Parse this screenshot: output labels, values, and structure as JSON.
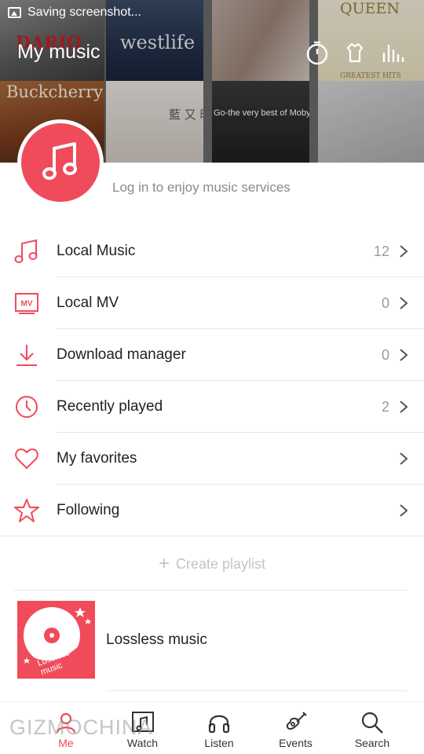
{
  "status_bar": {
    "text": "Saving screenshot..."
  },
  "header": {
    "title": "My music",
    "album_captions": [
      "DARIO",
      "westlife",
      "QUEEN",
      "GREATEST HITS",
      "Buckcherry",
      "藍 又 時",
      "Go-the very best of Moby"
    ]
  },
  "profile": {
    "login_hint": "Log in to enjoy music services"
  },
  "menu": [
    {
      "label": "Local Music",
      "count": "12",
      "icon": "music-note-icon"
    },
    {
      "label": "Local MV",
      "count": "0",
      "icon": "mv-icon"
    },
    {
      "label": "Download manager",
      "count": "0",
      "icon": "download-icon"
    },
    {
      "label": "Recently played",
      "count": "2",
      "icon": "clock-icon"
    },
    {
      "label": "My favorites",
      "count": "",
      "icon": "heart-icon"
    },
    {
      "label": "Following",
      "count": "",
      "icon": "star-icon"
    }
  ],
  "create_playlist": {
    "label": "Create playlist"
  },
  "playlist": {
    "label": "Lossless music",
    "cover_text": "Lossless music"
  },
  "bottom_nav": [
    {
      "label": "Me",
      "icon": "user-icon"
    },
    {
      "label": "Watch",
      "icon": "video-icon"
    },
    {
      "label": "Listen",
      "icon": "headphones-icon"
    },
    {
      "label": "Events",
      "icon": "guitar-icon"
    },
    {
      "label": "Search",
      "icon": "search-icon"
    }
  ],
  "watermark": "GIZMOCHINA",
  "colors": {
    "accent": "#ef4b5a"
  }
}
